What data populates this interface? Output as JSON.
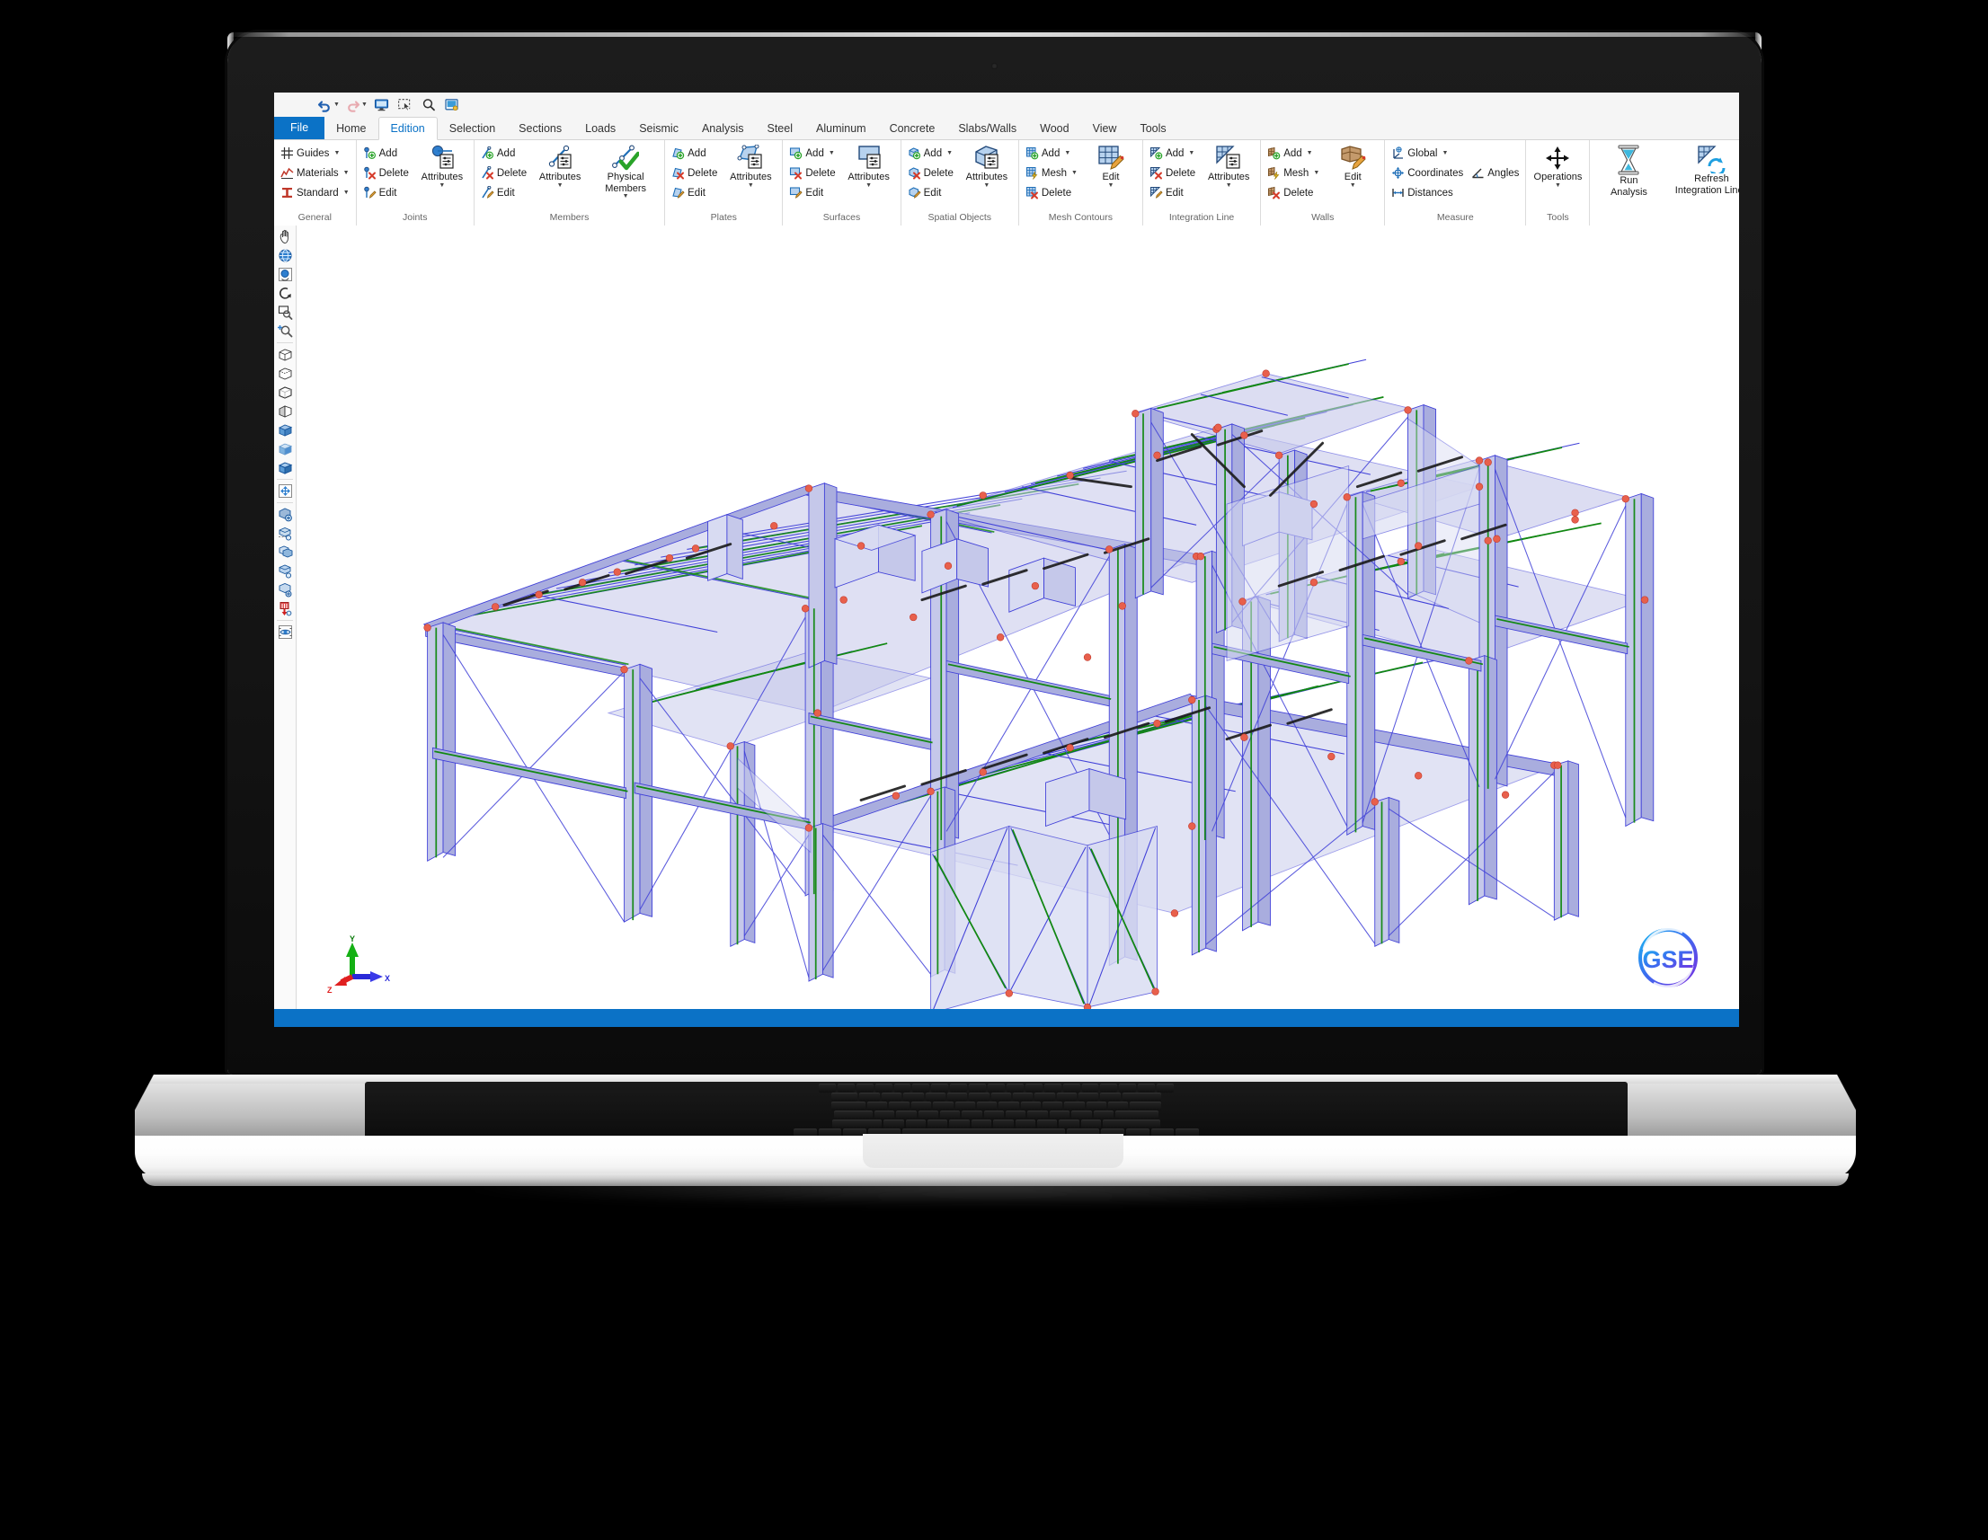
{
  "window": {
    "app_name": "GSE",
    "statusbar_color": "#0b72c6"
  },
  "quick_access": {
    "items": [
      {
        "name": "undo-button",
        "icon": "undo-icon",
        "has_dropdown": true
      },
      {
        "name": "redo-button",
        "icon": "redo-icon",
        "has_dropdown": true
      },
      {
        "name": "display-button",
        "icon": "monitor-icon",
        "has_dropdown": false
      },
      {
        "name": "select-region-button",
        "icon": "marquee-select-icon",
        "has_dropdown": false
      },
      {
        "name": "zoom-button",
        "icon": "magnifier-icon",
        "has_dropdown": false
      },
      {
        "name": "snapshot-button",
        "icon": "screenshot-icon",
        "has_dropdown": false
      }
    ]
  },
  "tabs": [
    {
      "label": "File",
      "type": "file"
    },
    {
      "label": "Home",
      "type": "normal"
    },
    {
      "label": "Edition",
      "type": "active"
    },
    {
      "label": "Selection",
      "type": "normal"
    },
    {
      "label": "Sections",
      "type": "normal"
    },
    {
      "label": "Loads",
      "type": "normal"
    },
    {
      "label": "Seismic",
      "type": "normal"
    },
    {
      "label": "Analysis",
      "type": "normal"
    },
    {
      "label": "Steel",
      "type": "normal"
    },
    {
      "label": "Aluminum",
      "type": "normal"
    },
    {
      "label": "Concrete",
      "type": "normal"
    },
    {
      "label": "Slabs/Walls",
      "type": "normal"
    },
    {
      "label": "Wood",
      "type": "normal"
    },
    {
      "label": "View",
      "type": "normal"
    },
    {
      "label": "Tools",
      "type": "normal"
    }
  ],
  "ribbon": {
    "groups": [
      {
        "key": "general",
        "label": "General",
        "small_items": [
          {
            "label": "Guides",
            "icon": "grid-guides-icon",
            "dropdown": true
          },
          {
            "label": "Materials",
            "icon": "materials-curve-icon",
            "dropdown": true
          },
          {
            "label": "Standard",
            "icon": "i-beam-icon",
            "dropdown": true
          }
        ],
        "big_items": []
      },
      {
        "key": "joints",
        "label": "Joints",
        "small_items": [
          {
            "label": "Add",
            "icon": "joint-add-icon",
            "dropdown": false
          },
          {
            "label": "Delete",
            "icon": "joint-delete-icon",
            "dropdown": false
          },
          {
            "label": "Edit",
            "icon": "joint-edit-icon",
            "dropdown": false
          }
        ],
        "big_items": [
          {
            "label": "Attributes",
            "label2": "",
            "icon": "joint-attributes-icon",
            "dropdown": true
          }
        ]
      },
      {
        "key": "members",
        "label": "Members",
        "small_items": [
          {
            "label": "Add",
            "icon": "member-add-icon",
            "dropdown": false
          },
          {
            "label": "Delete",
            "icon": "member-delete-icon",
            "dropdown": false
          },
          {
            "label": "Edit",
            "icon": "member-edit-icon",
            "dropdown": false
          }
        ],
        "big_items": [
          {
            "label": "Attributes",
            "label2": "",
            "icon": "member-attributes-icon",
            "dropdown": true
          },
          {
            "label": "Physical",
            "label2": "Members",
            "icon": "physical-members-icon",
            "dropdown": true
          }
        ]
      },
      {
        "key": "plates",
        "label": "Plates",
        "small_items": [
          {
            "label": "Add",
            "icon": "plate-add-icon",
            "dropdown": false
          },
          {
            "label": "Delete",
            "icon": "plate-delete-icon",
            "dropdown": false
          },
          {
            "label": "Edit",
            "icon": "plate-edit-icon",
            "dropdown": false
          }
        ],
        "big_items": [
          {
            "label": "Attributes",
            "label2": "",
            "icon": "plate-attributes-icon",
            "dropdown": true
          }
        ]
      },
      {
        "key": "surfaces",
        "label": "Surfaces",
        "small_items": [
          {
            "label": "Add",
            "icon": "surface-add-icon",
            "dropdown": true
          },
          {
            "label": "Delete",
            "icon": "surface-delete-icon",
            "dropdown": false
          },
          {
            "label": "Edit",
            "icon": "surface-edit-icon",
            "dropdown": false
          }
        ],
        "big_items": [
          {
            "label": "Attributes",
            "label2": "",
            "icon": "surface-attributes-icon",
            "dropdown": true
          }
        ]
      },
      {
        "key": "spatial_objects",
        "label": "Spatial Objects",
        "small_items": [
          {
            "label": "Add",
            "icon": "spatial-add-icon",
            "dropdown": true
          },
          {
            "label": "Delete",
            "icon": "spatial-delete-icon",
            "dropdown": false
          },
          {
            "label": "Edit",
            "icon": "spatial-edit-icon",
            "dropdown": false
          }
        ],
        "big_items": [
          {
            "label": "Attributes",
            "label2": "",
            "icon": "spatial-attributes-icon",
            "dropdown": true
          }
        ]
      },
      {
        "key": "mesh_contours",
        "label": "Mesh Contours",
        "small_items": [
          {
            "label": "Add",
            "icon": "mesh-add-icon",
            "dropdown": true
          },
          {
            "label": "Mesh",
            "icon": "mesh-generate-icon",
            "dropdown": true
          },
          {
            "label": "Delete",
            "icon": "mesh-delete-icon",
            "dropdown": false
          }
        ],
        "big_items": [
          {
            "label": "Edit",
            "label2": "",
            "icon": "mesh-edit-icon",
            "dropdown": true
          }
        ]
      },
      {
        "key": "integration_line",
        "label": "Integration Line",
        "small_items": [
          {
            "label": "Add",
            "icon": "integration-add-icon",
            "dropdown": true
          },
          {
            "label": "Delete",
            "icon": "integration-delete-icon",
            "dropdown": false
          },
          {
            "label": "Edit",
            "icon": "integration-edit-icon",
            "dropdown": false
          }
        ],
        "big_items": [
          {
            "label": "Attributes",
            "label2": "",
            "icon": "integration-attributes-icon",
            "dropdown": true
          }
        ]
      },
      {
        "key": "walls",
        "label": "Walls",
        "small_items": [
          {
            "label": "Add",
            "icon": "wall-add-icon",
            "dropdown": true
          },
          {
            "label": "Mesh",
            "icon": "wall-mesh-icon",
            "dropdown": true
          },
          {
            "label": "Delete",
            "icon": "wall-delete-icon",
            "dropdown": false
          }
        ],
        "big_items": [
          {
            "label": "Edit",
            "label2": "",
            "icon": "wall-edit-icon",
            "dropdown": true
          }
        ]
      },
      {
        "key": "measure",
        "label": "Measure",
        "small_items": [
          {
            "label": "Global",
            "icon": "global-axes-icon",
            "dropdown": true
          },
          {
            "label": "Coordinates",
            "icon": "coordinates-icon",
            "dropdown": false
          },
          {
            "label": "Distances",
            "icon": "distance-icon",
            "dropdown": false
          },
          {
            "label": "Angles",
            "icon": "angle-icon",
            "dropdown": false
          }
        ],
        "big_items": []
      },
      {
        "key": "tools",
        "label": "Tools",
        "small_items": [],
        "big_items": [
          {
            "label": "Operations",
            "label2": "",
            "icon": "operations-move-icon",
            "dropdown": true
          }
        ]
      },
      {
        "key": "analysis_tools",
        "label": "",
        "small_items": [],
        "big_items": [
          {
            "label": "Run",
            "label2": "Analysis",
            "icon": "hourglass-icon",
            "dropdown": false
          },
          {
            "label": "Refresh",
            "label2": "Integration Lines",
            "icon": "refresh-integration-icon",
            "dropdown": false
          }
        ]
      }
    ]
  },
  "left_toolbar": {
    "items": [
      {
        "name": "pan-tool",
        "icon": "hand-pan-icon"
      },
      {
        "name": "orbit-globe-tool",
        "icon": "globe-icon"
      },
      {
        "name": "rotate-view-tool",
        "icon": "sphere-rotate-icon"
      },
      {
        "name": "rotate-tool",
        "icon": "rotate-arrow-icon"
      },
      {
        "name": "zoom-window-tool",
        "icon": "zoom-window-icon"
      },
      {
        "name": "zoom-in-tool",
        "icon": "zoom-in-icon"
      },
      {
        "name": "view-wireframe",
        "icon": "cube-wireframe-icon"
      },
      {
        "name": "view-hidden-line",
        "icon": "cube-hidden-icon"
      },
      {
        "name": "view-outline",
        "icon": "cube-outline-icon"
      },
      {
        "name": "view-half-shade",
        "icon": "cube-half-shaded-icon"
      },
      {
        "name": "view-shaded-edges",
        "icon": "cube-shaded-edges-icon"
      },
      {
        "name": "view-shaded",
        "icon": "cube-shaded-icon"
      },
      {
        "name": "view-solid",
        "icon": "cube-solid-icon"
      },
      {
        "name": "zoom-extents",
        "icon": "zoom-extents-icon"
      },
      {
        "name": "render-view",
        "icon": "render-icon"
      },
      {
        "name": "section-view",
        "icon": "section-cut-icon"
      },
      {
        "name": "clip-box",
        "icon": "clip-box-icon"
      },
      {
        "name": "display-layers",
        "icon": "layers-icon"
      },
      {
        "name": "view-settings",
        "icon": "view-settings-icon"
      },
      {
        "name": "supports-display",
        "icon": "supports-icon"
      },
      {
        "name": "preview-view",
        "icon": "eye-preview-icon"
      }
    ]
  },
  "viewport": {
    "background": "#ffffff",
    "model_name": "steel-frame-3d-model",
    "axes": [
      {
        "axis": "X",
        "color": "#2222dd"
      },
      {
        "axis": "Y",
        "color": "#00a000"
      },
      {
        "axis": "Z",
        "color": "#dd2222"
      }
    ],
    "logo_text": "GSE",
    "model_colors": {
      "member_fill": "#c5c8ea",
      "member_edge": "#4040d8",
      "beam_line": "#118811",
      "node": "#e8604c",
      "brace": "#1a1a1a"
    }
  }
}
